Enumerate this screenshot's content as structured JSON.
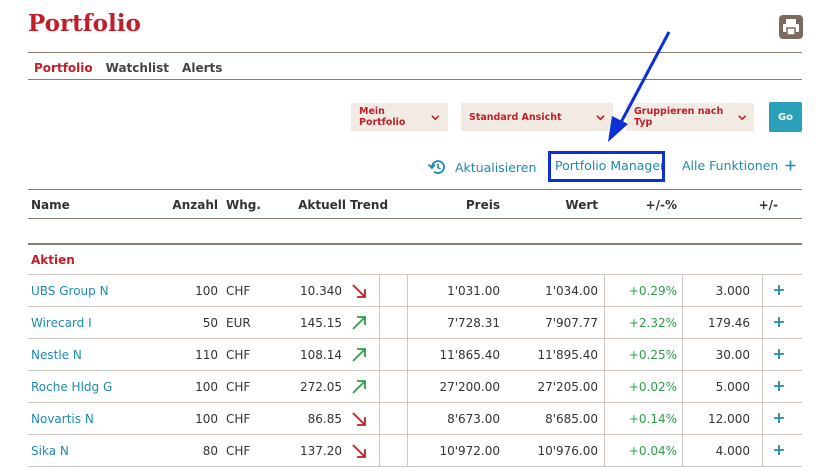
{
  "header": {
    "title": "Portfolio",
    "print_icon": "printer-icon"
  },
  "tabs": [
    {
      "label": "Portfolio",
      "active": true
    },
    {
      "label": "Watchlist",
      "active": false
    },
    {
      "label": "Alerts",
      "active": false
    }
  ],
  "controls": {
    "portfolio_select": "Mein Portfolio",
    "view_select": "Standard Ansicht",
    "group_select": "Gruppieren nach Typ",
    "go_label": "Go"
  },
  "actions": {
    "refresh_label": "Aktualisieren",
    "portfolio_manager_label": "Portfolio Manager",
    "all_functions_label": "Alle Funktionen"
  },
  "table": {
    "headers": {
      "name": "Name",
      "anzahl": "Anzahl",
      "whg": "Whg.",
      "aktuell": "Aktuell",
      "trend": "Trend",
      "preis": "Preis",
      "wert": "Wert",
      "pct": "+/-%",
      "diff": "+/-"
    },
    "section_label": "Aktien",
    "rows": [
      {
        "name": "UBS Group N",
        "anzahl": "100",
        "whg": "CHF",
        "aktuell": "10.340",
        "trend": "down",
        "preis": "1'031.00",
        "wert": "1'034.00",
        "pct": "+0.29%",
        "diff": "3.000"
      },
      {
        "name": "Wirecard I",
        "anzahl": "50",
        "whg": "EUR",
        "aktuell": "145.15",
        "trend": "up",
        "preis": "7'728.31",
        "wert": "7'907.77",
        "pct": "+2.32%",
        "diff": "179.46"
      },
      {
        "name": "Nestle N",
        "anzahl": "110",
        "whg": "CHF",
        "aktuell": "108.14",
        "trend": "up",
        "preis": "11'865.40",
        "wert": "11'895.40",
        "pct": "+0.25%",
        "diff": "30.00"
      },
      {
        "name": "Roche Hldg G",
        "anzahl": "100",
        "whg": "CHF",
        "aktuell": "272.05",
        "trend": "up",
        "preis": "27'200.00",
        "wert": "27'205.00",
        "pct": "+0.02%",
        "diff": "5.000"
      },
      {
        "name": "Novartis N",
        "anzahl": "100",
        "whg": "CHF",
        "aktuell": "86.85",
        "trend": "down",
        "preis": "8'673.00",
        "wert": "8'685.00",
        "pct": "+0.14%",
        "diff": "12.000"
      },
      {
        "name": "Sika N",
        "anzahl": "80",
        "whg": "CHF",
        "aktuell": "137.20",
        "trend": "down",
        "preis": "10'972.00",
        "wert": "10'976.00",
        "pct": "+0.04%",
        "diff": "4.000"
      }
    ]
  },
  "colors": {
    "brand_red": "#c21e2a",
    "link_blue": "#1e8bb0",
    "accent_teal": "#2aa0b8",
    "positive_green": "#2e9e4a",
    "annotation_blue": "#0b31d6"
  }
}
